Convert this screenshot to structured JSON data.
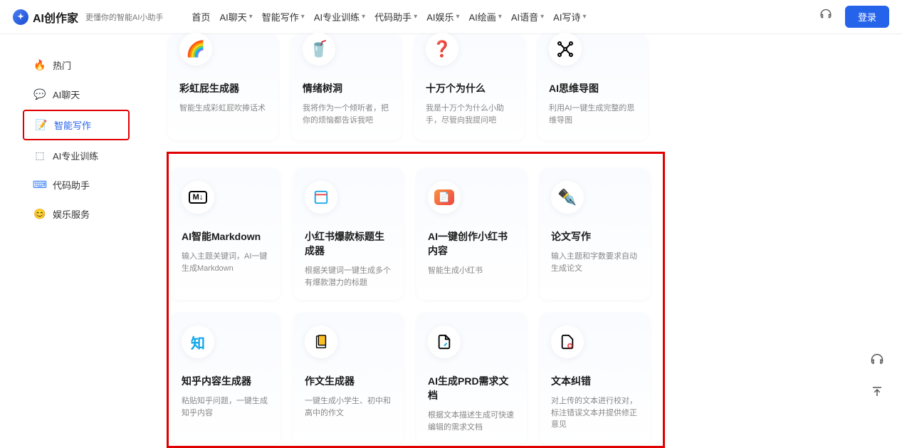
{
  "header": {
    "logo_text": "AI创作家",
    "tagline": "更懂你的智能AI小助手",
    "nav": [
      {
        "label": "首页",
        "has_dropdown": false
      },
      {
        "label": "AI聊天",
        "has_dropdown": true
      },
      {
        "label": "智能写作",
        "has_dropdown": true
      },
      {
        "label": "AI专业训练",
        "has_dropdown": true
      },
      {
        "label": "代码助手",
        "has_dropdown": true
      },
      {
        "label": "AI娱乐",
        "has_dropdown": true
      },
      {
        "label": "AI绘画",
        "has_dropdown": true
      },
      {
        "label": "AI语音",
        "has_dropdown": true
      },
      {
        "label": "AI写诗",
        "has_dropdown": true
      }
    ],
    "login": "登录"
  },
  "sidebar": [
    {
      "icon": "fire",
      "label": "热门",
      "color": "#f59e0b"
    },
    {
      "icon": "chat",
      "label": "AI聊天",
      "color": "#3b82f6"
    },
    {
      "icon": "doc",
      "label": "智能写作",
      "color": "#2563eb",
      "active": true
    },
    {
      "icon": "cube",
      "label": "AI专业训练",
      "color": "#6b7280"
    },
    {
      "icon": "code",
      "label": "代码助手",
      "color": "#3b82f6"
    },
    {
      "icon": "smile",
      "label": "娱乐服务",
      "color": "#3b82f6"
    }
  ],
  "top_cards": [
    {
      "title": "彩虹屁生成器",
      "desc": "智能生成彩虹屁吹捧话术"
    },
    {
      "title": "情绪树洞",
      "desc": "我将作为一个倾听者，把你的烦恼都告诉我吧"
    },
    {
      "title": "十万个为什么",
      "desc": "我是十万个为什么小助手，尽管向我提问吧"
    },
    {
      "title": "AI思维导图",
      "desc": "利用AI一键生成完整的思维导图"
    }
  ],
  "grid_cards": [
    [
      {
        "title": "AI智能Markdown",
        "desc": "输入主题关键词，AI一键生成Markdown"
      },
      {
        "title": "小红书爆款标题生成器",
        "desc": "根据关键词一键生成多个有爆款潜力的标题"
      },
      {
        "title": "AI一键创作小红书内容",
        "desc": "智能生成小红书"
      },
      {
        "title": "论文写作",
        "desc": "输入主题和字数要求自动生成论文"
      }
    ],
    [
      {
        "title": "知乎内容生成器",
        "desc": "粘贴知乎问题，一键生成知乎内容"
      },
      {
        "title": "作文生成器",
        "desc": "一键生成小学生、初中和高中的作文"
      },
      {
        "title": "AI生成PRD需求文档",
        "desc": "根据文本描述生成可快速编辑的需求文档"
      },
      {
        "title": "文本纠错",
        "desc": "对上传的文本进行校对，标注错误文本并提供修正意见"
      }
    ]
  ]
}
